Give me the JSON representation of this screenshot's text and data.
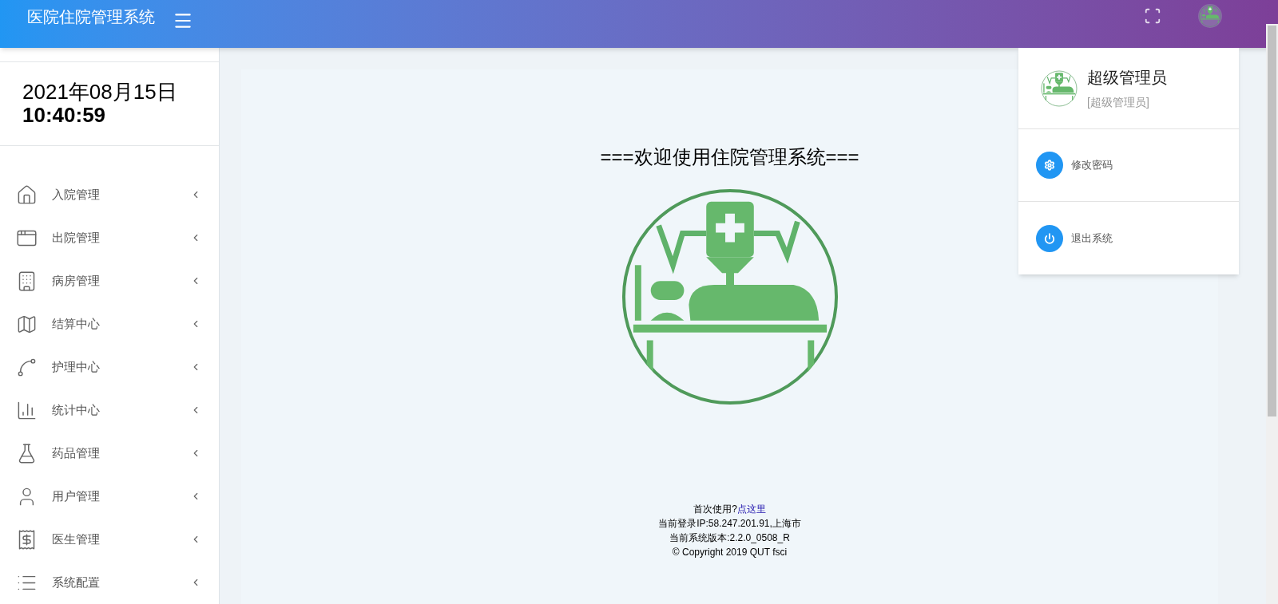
{
  "header": {
    "title": "医院住院管理系统"
  },
  "sidebar": {
    "date": "2021年08月15日",
    "time": "10:40:59",
    "items": [
      {
        "label": "入院管理",
        "kind": "home"
      },
      {
        "label": "出院管理",
        "kind": "windows"
      },
      {
        "label": "病房管理",
        "kind": "building"
      },
      {
        "label": "结算中心",
        "kind": "map"
      },
      {
        "label": "护理中心",
        "kind": "trend"
      },
      {
        "label": "统计中心",
        "kind": "bars"
      },
      {
        "label": "药品管理",
        "kind": "flask"
      },
      {
        "label": "用户管理",
        "kind": "user"
      },
      {
        "label": "医生管理",
        "kind": "cheque"
      },
      {
        "label": "系统配置",
        "kind": "list"
      }
    ]
  },
  "main": {
    "welcome": "===欢迎使用住院管理系统===",
    "first_use": "首次使用?",
    "first_use_link": "点这里",
    "login_ip": "当前登录IP:58.247.201.91,上海市",
    "version": "当前系统版本:2.2.0_0508_R",
    "copyright": "© Copyright 2019 QUT fsci"
  },
  "user_menu": {
    "name": "超级管理员",
    "role": "[超级管理员]",
    "actions": [
      {
        "label": "修改密码",
        "kind": "gear"
      },
      {
        "label": "退出系统",
        "kind": "power"
      }
    ]
  }
}
